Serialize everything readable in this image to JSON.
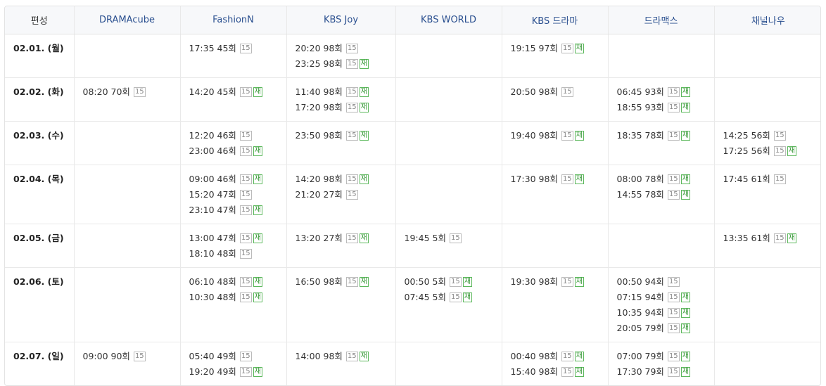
{
  "header": {
    "first": "편성",
    "channels": [
      "DRAMAcube",
      "FashionN",
      "KBS Joy",
      "KBS WORLD",
      "KBS 드라마",
      "드라맥스",
      "채널나우"
    ]
  },
  "badges": {
    "rating": "15",
    "rerun": "재"
  },
  "rows": [
    {
      "date": "02.01. (월)",
      "cells": [
        [],
        [
          {
            "time": "17:35",
            "ep": "45회",
            "re": false
          }
        ],
        [
          {
            "time": "20:20",
            "ep": "98회",
            "re": false
          },
          {
            "time": "23:25",
            "ep": "98회",
            "re": true
          }
        ],
        [],
        [
          {
            "time": "19:15",
            "ep": "97회",
            "re": true
          }
        ],
        [],
        []
      ]
    },
    {
      "date": "02.02. (화)",
      "cells": [
        [
          {
            "time": "08:20",
            "ep": "70회",
            "re": false
          }
        ],
        [
          {
            "time": "14:20",
            "ep": "45회",
            "re": true
          }
        ],
        [
          {
            "time": "11:40",
            "ep": "98회",
            "re": true
          },
          {
            "time": "17:20",
            "ep": "98회",
            "re": true
          }
        ],
        [],
        [
          {
            "time": "20:50",
            "ep": "98회",
            "re": false
          }
        ],
        [
          {
            "time": "06:45",
            "ep": "93회",
            "re": true
          },
          {
            "time": "18:55",
            "ep": "93회",
            "re": true
          }
        ],
        []
      ]
    },
    {
      "date": "02.03. (수)",
      "cells": [
        [],
        [
          {
            "time": "12:20",
            "ep": "46회",
            "re": false
          },
          {
            "time": "23:00",
            "ep": "46회",
            "re": true
          }
        ],
        [
          {
            "time": "23:50",
            "ep": "98회",
            "re": true
          }
        ],
        [],
        [
          {
            "time": "19:40",
            "ep": "98회",
            "re": true
          }
        ],
        [
          {
            "time": "18:35",
            "ep": "78회",
            "re": true
          }
        ],
        [
          {
            "time": "14:25",
            "ep": "56회",
            "re": false
          },
          {
            "time": "17:25",
            "ep": "56회",
            "re": true
          }
        ]
      ]
    },
    {
      "date": "02.04. (목)",
      "cells": [
        [],
        [
          {
            "time": "09:00",
            "ep": "46회",
            "re": true
          },
          {
            "time": "15:20",
            "ep": "47회",
            "re": false
          },
          {
            "time": "23:10",
            "ep": "47회",
            "re": true
          }
        ],
        [
          {
            "time": "14:20",
            "ep": "98회",
            "re": true
          },
          {
            "time": "21:20",
            "ep": "27회",
            "re": false
          }
        ],
        [],
        [
          {
            "time": "17:30",
            "ep": "98회",
            "re": true
          }
        ],
        [
          {
            "time": "08:00",
            "ep": "78회",
            "re": true
          },
          {
            "time": "14:55",
            "ep": "78회",
            "re": true
          }
        ],
        [
          {
            "time": "17:45",
            "ep": "61회",
            "re": false
          }
        ]
      ]
    },
    {
      "date": "02.05. (금)",
      "cells": [
        [],
        [
          {
            "time": "13:00",
            "ep": "47회",
            "re": true
          },
          {
            "time": "18:10",
            "ep": "48회",
            "re": false
          }
        ],
        [
          {
            "time": "13:20",
            "ep": "27회",
            "re": true
          }
        ],
        [
          {
            "time": "19:45",
            "ep": "5회",
            "re": false
          }
        ],
        [],
        [],
        [
          {
            "time": "13:35",
            "ep": "61회",
            "re": true
          }
        ]
      ]
    },
    {
      "date": "02.06. (토)",
      "cells": [
        [],
        [
          {
            "time": "06:10",
            "ep": "48회",
            "re": true
          },
          {
            "time": "10:30",
            "ep": "48회",
            "re": true
          }
        ],
        [
          {
            "time": "16:50",
            "ep": "98회",
            "re": true
          }
        ],
        [
          {
            "time": "00:50",
            "ep": "5회",
            "re": true
          },
          {
            "time": "07:45",
            "ep": "5회",
            "re": true
          }
        ],
        [
          {
            "time": "19:30",
            "ep": "98회",
            "re": true
          }
        ],
        [
          {
            "time": "00:50",
            "ep": "94회",
            "re": false
          },
          {
            "time": "07:15",
            "ep": "94회",
            "re": true
          },
          {
            "time": "10:35",
            "ep": "94회",
            "re": true
          },
          {
            "time": "20:05",
            "ep": "79회",
            "re": true
          }
        ],
        []
      ]
    },
    {
      "date": "02.07. (일)",
      "cells": [
        [
          {
            "time": "09:00",
            "ep": "90회",
            "re": false
          }
        ],
        [
          {
            "time": "05:40",
            "ep": "49회",
            "re": false
          },
          {
            "time": "19:20",
            "ep": "49회",
            "re": true
          }
        ],
        [
          {
            "time": "14:00",
            "ep": "98회",
            "re": true
          }
        ],
        [],
        [
          {
            "time": "00:40",
            "ep": "98회",
            "re": true
          },
          {
            "time": "15:40",
            "ep": "98회",
            "re": true
          }
        ],
        [
          {
            "time": "07:00",
            "ep": "79회",
            "re": true
          },
          {
            "time": "17:30",
            "ep": "79회",
            "re": true
          }
        ],
        []
      ]
    }
  ]
}
